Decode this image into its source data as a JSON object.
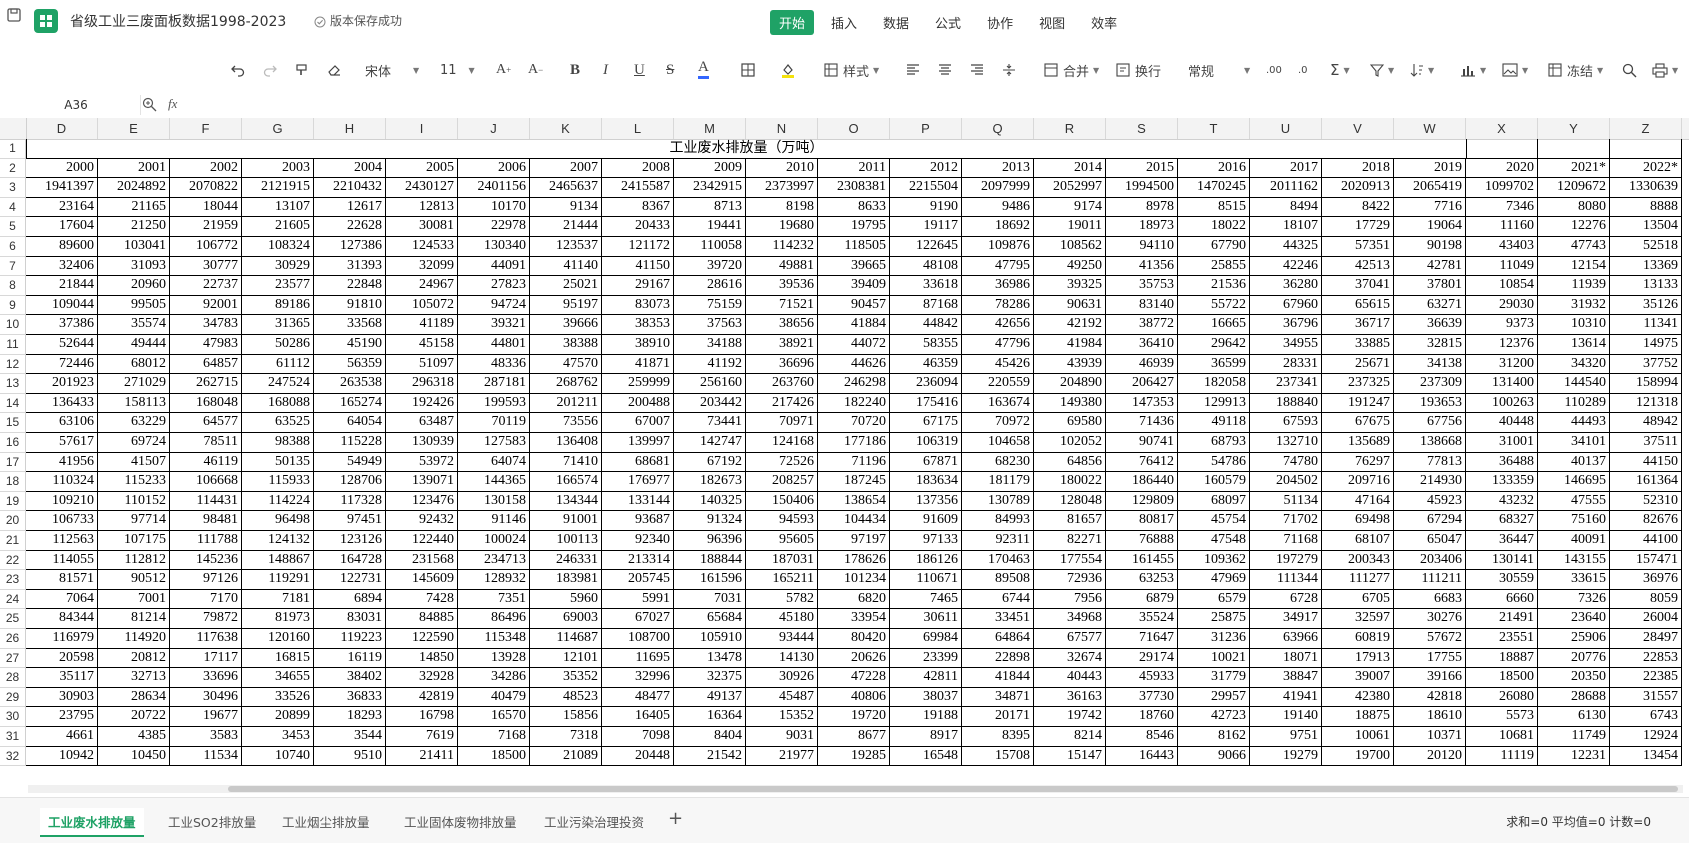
{
  "app": {
    "title": "省级工业三废面板数据1998-2023",
    "save_status": "版本保存成功"
  },
  "menu": {
    "tabs": [
      "开始",
      "插入",
      "数据",
      "公式",
      "协作",
      "视图",
      "效率"
    ],
    "active": "开始"
  },
  "toolbar": {
    "font_name": "宋体",
    "font_size": "11",
    "style_label": "样式",
    "merge_label": "合并",
    "wrap_label": "换行",
    "format_label": "常规",
    "freeze_label": "冻结"
  },
  "formula_bar": {
    "name_box": "A36",
    "fx_label": "fx",
    "content": ""
  },
  "columns": [
    "D",
    "E",
    "F",
    "G",
    "H",
    "I",
    "J",
    "K",
    "L",
    "M",
    "N",
    "O",
    "P",
    "Q",
    "R",
    "S",
    "T",
    "U",
    "V",
    "W",
    "X",
    "Y",
    "Z"
  ],
  "rows": [
    "1",
    "2",
    "3",
    "4",
    "5",
    "6",
    "7",
    "8",
    "9",
    "10",
    "11",
    "12",
    "13",
    "14",
    "15",
    "16",
    "17",
    "18",
    "19",
    "20",
    "21",
    "22",
    "23",
    "24",
    "25",
    "26",
    "27",
    "28",
    "29",
    "30",
    "31",
    "32"
  ],
  "sheet_title": "工业废水排放量（万吨）",
  "years": [
    "2000",
    "2001",
    "2002",
    "2003",
    "2004",
    "2005",
    "2006",
    "2007",
    "2008",
    "2009",
    "2010",
    "2011",
    "2012",
    "2013",
    "2014",
    "2015",
    "2016",
    "2017",
    "2018",
    "2019",
    "2020",
    "2021*",
    "2022*"
  ],
  "table": [
    [
      "1941397",
      "2024892",
      "2070822",
      "2121915",
      "2210432",
      "2430127",
      "2401156",
      "2465637",
      "2415587",
      "2342915",
      "2373997",
      "2308381",
      "2215504",
      "2097999",
      "2052997",
      "1994500",
      "1470245",
      "2011162",
      "2020913",
      "2065419",
      "1099702",
      "1209672",
      "1330639"
    ],
    [
      "23164",
      "21165",
      "18044",
      "13107",
      "12617",
      "12813",
      "10170",
      "9134",
      "8367",
      "8713",
      "8198",
      "8633",
      "9190",
      "9486",
      "9174",
      "8978",
      "8515",
      "8494",
      "8422",
      "7716",
      "7346",
      "8080",
      "8888"
    ],
    [
      "17604",
      "21250",
      "21959",
      "21605",
      "22628",
      "30081",
      "22978",
      "21444",
      "20433",
      "19441",
      "19680",
      "19795",
      "19117",
      "18692",
      "19011",
      "18973",
      "18022",
      "18107",
      "17729",
      "19064",
      "11160",
      "12276",
      "13504"
    ],
    [
      "89600",
      "103041",
      "106772",
      "108324",
      "127386",
      "124533",
      "130340",
      "123537",
      "121172",
      "110058",
      "114232",
      "118505",
      "122645",
      "109876",
      "108562",
      "94110",
      "67790",
      "44325",
      "57351",
      "90198",
      "43403",
      "47743",
      "52518"
    ],
    [
      "32406",
      "31093",
      "30777",
      "30929",
      "31393",
      "32099",
      "44091",
      "41140",
      "41150",
      "39720",
      "49881",
      "39665",
      "48108",
      "47795",
      "49250",
      "41356",
      "25855",
      "42246",
      "42513",
      "42781",
      "11049",
      "12154",
      "13369"
    ],
    [
      "21844",
      "20960",
      "22737",
      "23577",
      "22848",
      "24967",
      "27823",
      "25021",
      "29167",
      "28616",
      "39536",
      "39409",
      "33618",
      "36986",
      "39325",
      "35753",
      "21536",
      "36280",
      "37041",
      "37801",
      "10854",
      "11939",
      "13133"
    ],
    [
      "109044",
      "99505",
      "92001",
      "89186",
      "91810",
      "105072",
      "94724",
      "95197",
      "83073",
      "75159",
      "71521",
      "90457",
      "87168",
      "78286",
      "90631",
      "83140",
      "55722",
      "67960",
      "65615",
      "63271",
      "29030",
      "31932",
      "35126"
    ],
    [
      "37386",
      "35574",
      "34783",
      "31365",
      "33568",
      "41189",
      "39321",
      "39666",
      "38353",
      "37563",
      "38656",
      "41884",
      "44842",
      "42656",
      "42192",
      "38772",
      "16665",
      "36796",
      "36717",
      "36639",
      "9373",
      "10310",
      "11341"
    ],
    [
      "52644",
      "49444",
      "47983",
      "50286",
      "45190",
      "45158",
      "44801",
      "38388",
      "38910",
      "34188",
      "38921",
      "44072",
      "58355",
      "47796",
      "41984",
      "36410",
      "29642",
      "34955",
      "33885",
      "32815",
      "12376",
      "13614",
      "14975"
    ],
    [
      "72446",
      "68012",
      "64857",
      "61112",
      "56359",
      "51097",
      "48336",
      "47570",
      "41871",
      "41192",
      "36696",
      "44626",
      "46359",
      "45426",
      "43939",
      "46939",
      "36599",
      "28331",
      "25671",
      "34138",
      "31200",
      "34320",
      "37752"
    ],
    [
      "201923",
      "271029",
      "262715",
      "247524",
      "263538",
      "296318",
      "287181",
      "268762",
      "259999",
      "256160",
      "263760",
      "246298",
      "236094",
      "220559",
      "204890",
      "206427",
      "182058",
      "237341",
      "237325",
      "237309",
      "131400",
      "144540",
      "158994"
    ],
    [
      "136433",
      "158113",
      "168048",
      "168088",
      "165274",
      "192426",
      "199593",
      "201211",
      "200488",
      "203442",
      "217426",
      "182240",
      "175416",
      "163674",
      "149380",
      "147353",
      "129913",
      "188840",
      "191247",
      "193653",
      "100263",
      "110289",
      "121318"
    ],
    [
      "63106",
      "63229",
      "64577",
      "63525",
      "64054",
      "63487",
      "70119",
      "73556",
      "67007",
      "73441",
      "70971",
      "70720",
      "67175",
      "70972",
      "69580",
      "71436",
      "49118",
      "67593",
      "67675",
      "67756",
      "40448",
      "44493",
      "48942"
    ],
    [
      "57617",
      "69724",
      "78511",
      "98388",
      "115228",
      "130939",
      "127583",
      "136408",
      "139997",
      "142747",
      "124168",
      "177186",
      "106319",
      "104658",
      "102052",
      "90741",
      "68793",
      "132710",
      "135689",
      "138668",
      "31001",
      "34101",
      "37511"
    ],
    [
      "41956",
      "41507",
      "46119",
      "50135",
      "54949",
      "53972",
      "64074",
      "71410",
      "68681",
      "67192",
      "72526",
      "71196",
      "67871",
      "68230",
      "64856",
      "76412",
      "54786",
      "74780",
      "76297",
      "77813",
      "36488",
      "40137",
      "44150"
    ],
    [
      "110324",
      "115233",
      "106668",
      "115933",
      "128706",
      "139071",
      "144365",
      "166574",
      "176977",
      "182673",
      "208257",
      "187245",
      "183634",
      "181179",
      "180022",
      "186440",
      "160579",
      "204502",
      "209716",
      "214930",
      "133359",
      "146695",
      "161364"
    ],
    [
      "109210",
      "110152",
      "114431",
      "114224",
      "117328",
      "123476",
      "130158",
      "134344",
      "133144",
      "140325",
      "150406",
      "138654",
      "137356",
      "130789",
      "128048",
      "129809",
      "68097",
      "51134",
      "47164",
      "45923",
      "43232",
      "47555",
      "52310"
    ],
    [
      "106733",
      "97714",
      "98481",
      "96498",
      "97451",
      "92432",
      "91146",
      "91001",
      "93687",
      "91324",
      "94593",
      "104434",
      "91609",
      "84993",
      "81657",
      "80817",
      "45754",
      "71702",
      "69498",
      "67294",
      "68327",
      "75160",
      "82676"
    ],
    [
      "112563",
      "107175",
      "111788",
      "124132",
      "123126",
      "122440",
      "100024",
      "100113",
      "92340",
      "96396",
      "95605",
      "97197",
      "97133",
      "92311",
      "82271",
      "76888",
      "47548",
      "71168",
      "68107",
      "65047",
      "36447",
      "40091",
      "44100"
    ],
    [
      "114055",
      "112812",
      "145236",
      "148867",
      "164728",
      "231568",
      "234713",
      "246331",
      "213314",
      "188844",
      "187031",
      "178626",
      "186126",
      "170463",
      "177554",
      "161455",
      "109362",
      "197279",
      "200343",
      "203406",
      "130141",
      "143155",
      "157471"
    ],
    [
      "81571",
      "90512",
      "97126",
      "119291",
      "122731",
      "145609",
      "128932",
      "183981",
      "205745",
      "161596",
      "165211",
      "101234",
      "110671",
      "89508",
      "72936",
      "63253",
      "47969",
      "111344",
      "111277",
      "111211",
      "30559",
      "33615",
      "36976"
    ],
    [
      "7064",
      "7001",
      "7170",
      "7181",
      "6894",
      "7428",
      "7351",
      "5960",
      "5991",
      "7031",
      "5782",
      "6820",
      "7465",
      "6744",
      "7956",
      "6879",
      "6579",
      "6728",
      "6705",
      "6683",
      "6660",
      "7326",
      "8059"
    ],
    [
      "84344",
      "81214",
      "79872",
      "81973",
      "83031",
      "84885",
      "86496",
      "69003",
      "67027",
      "65684",
      "45180",
      "33954",
      "30611",
      "33451",
      "34968",
      "35524",
      "25875",
      "34917",
      "32597",
      "30276",
      "21491",
      "23640",
      "26004"
    ],
    [
      "116979",
      "114920",
      "117638",
      "120160",
      "119223",
      "122590",
      "115348",
      "114687",
      "108700",
      "105910",
      "93444",
      "80420",
      "69984",
      "64864",
      "67577",
      "71647",
      "31236",
      "63966",
      "60819",
      "57672",
      "23551",
      "25906",
      "28497"
    ],
    [
      "20598",
      "20812",
      "17117",
      "16815",
      "16119",
      "14850",
      "13928",
      "12101",
      "11695",
      "13478",
      "14130",
      "20626",
      "23399",
      "22898",
      "32674",
      "29174",
      "10021",
      "18071",
      "17913",
      "17755",
      "18887",
      "20776",
      "22853"
    ],
    [
      "35117",
      "32713",
      "33696",
      "34655",
      "38402",
      "32928",
      "34286",
      "35352",
      "32996",
      "32375",
      "30926",
      "47228",
      "42811",
      "41844",
      "40443",
      "45933",
      "31779",
      "38847",
      "39007",
      "39166",
      "18500",
      "20350",
      "22385"
    ],
    [
      "30903",
      "28634",
      "30496",
      "33526",
      "36833",
      "42819",
      "40479",
      "48523",
      "48477",
      "49137",
      "45487",
      "40806",
      "38037",
      "34871",
      "36163",
      "37730",
      "29957",
      "41941",
      "42380",
      "42818",
      "26080",
      "28688",
      "31557"
    ],
    [
      "23795",
      "20722",
      "19677",
      "20899",
      "18293",
      "16798",
      "16570",
      "15856",
      "16405",
      "16364",
      "15352",
      "19720",
      "19188",
      "20171",
      "19742",
      "18760",
      "42723",
      "19140",
      "18875",
      "18610",
      "5573",
      "6130",
      "6743"
    ],
    [
      "4661",
      "4385",
      "3583",
      "3453",
      "3544",
      "7619",
      "7168",
      "7318",
      "7098",
      "8404",
      "9031",
      "8677",
      "8917",
      "8395",
      "8214",
      "8546",
      "8162",
      "9751",
      "10061",
      "10371",
      "10681",
      "11749",
      "12924"
    ],
    [
      "10942",
      "10450",
      "11534",
      "10740",
      "9510",
      "21411",
      "18500",
      "21089",
      "20448",
      "21542",
      "21977",
      "19285",
      "16548",
      "15708",
      "15147",
      "16443",
      "9066",
      "19279",
      "19700",
      "20120",
      "11119",
      "12231",
      "13454"
    ]
  ],
  "sheet_tabs": [
    "工业废水排放量",
    "工业SO2排放量",
    "工业烟尘排放量",
    "工业固体废物排放量",
    "工业污染治理投资"
  ],
  "active_sheet": "工业废水排放量",
  "add_sheet_label": "+",
  "status_bar": "求和=0  平均值=0  计数=0",
  "colors": {
    "accent": "#1fa266"
  }
}
